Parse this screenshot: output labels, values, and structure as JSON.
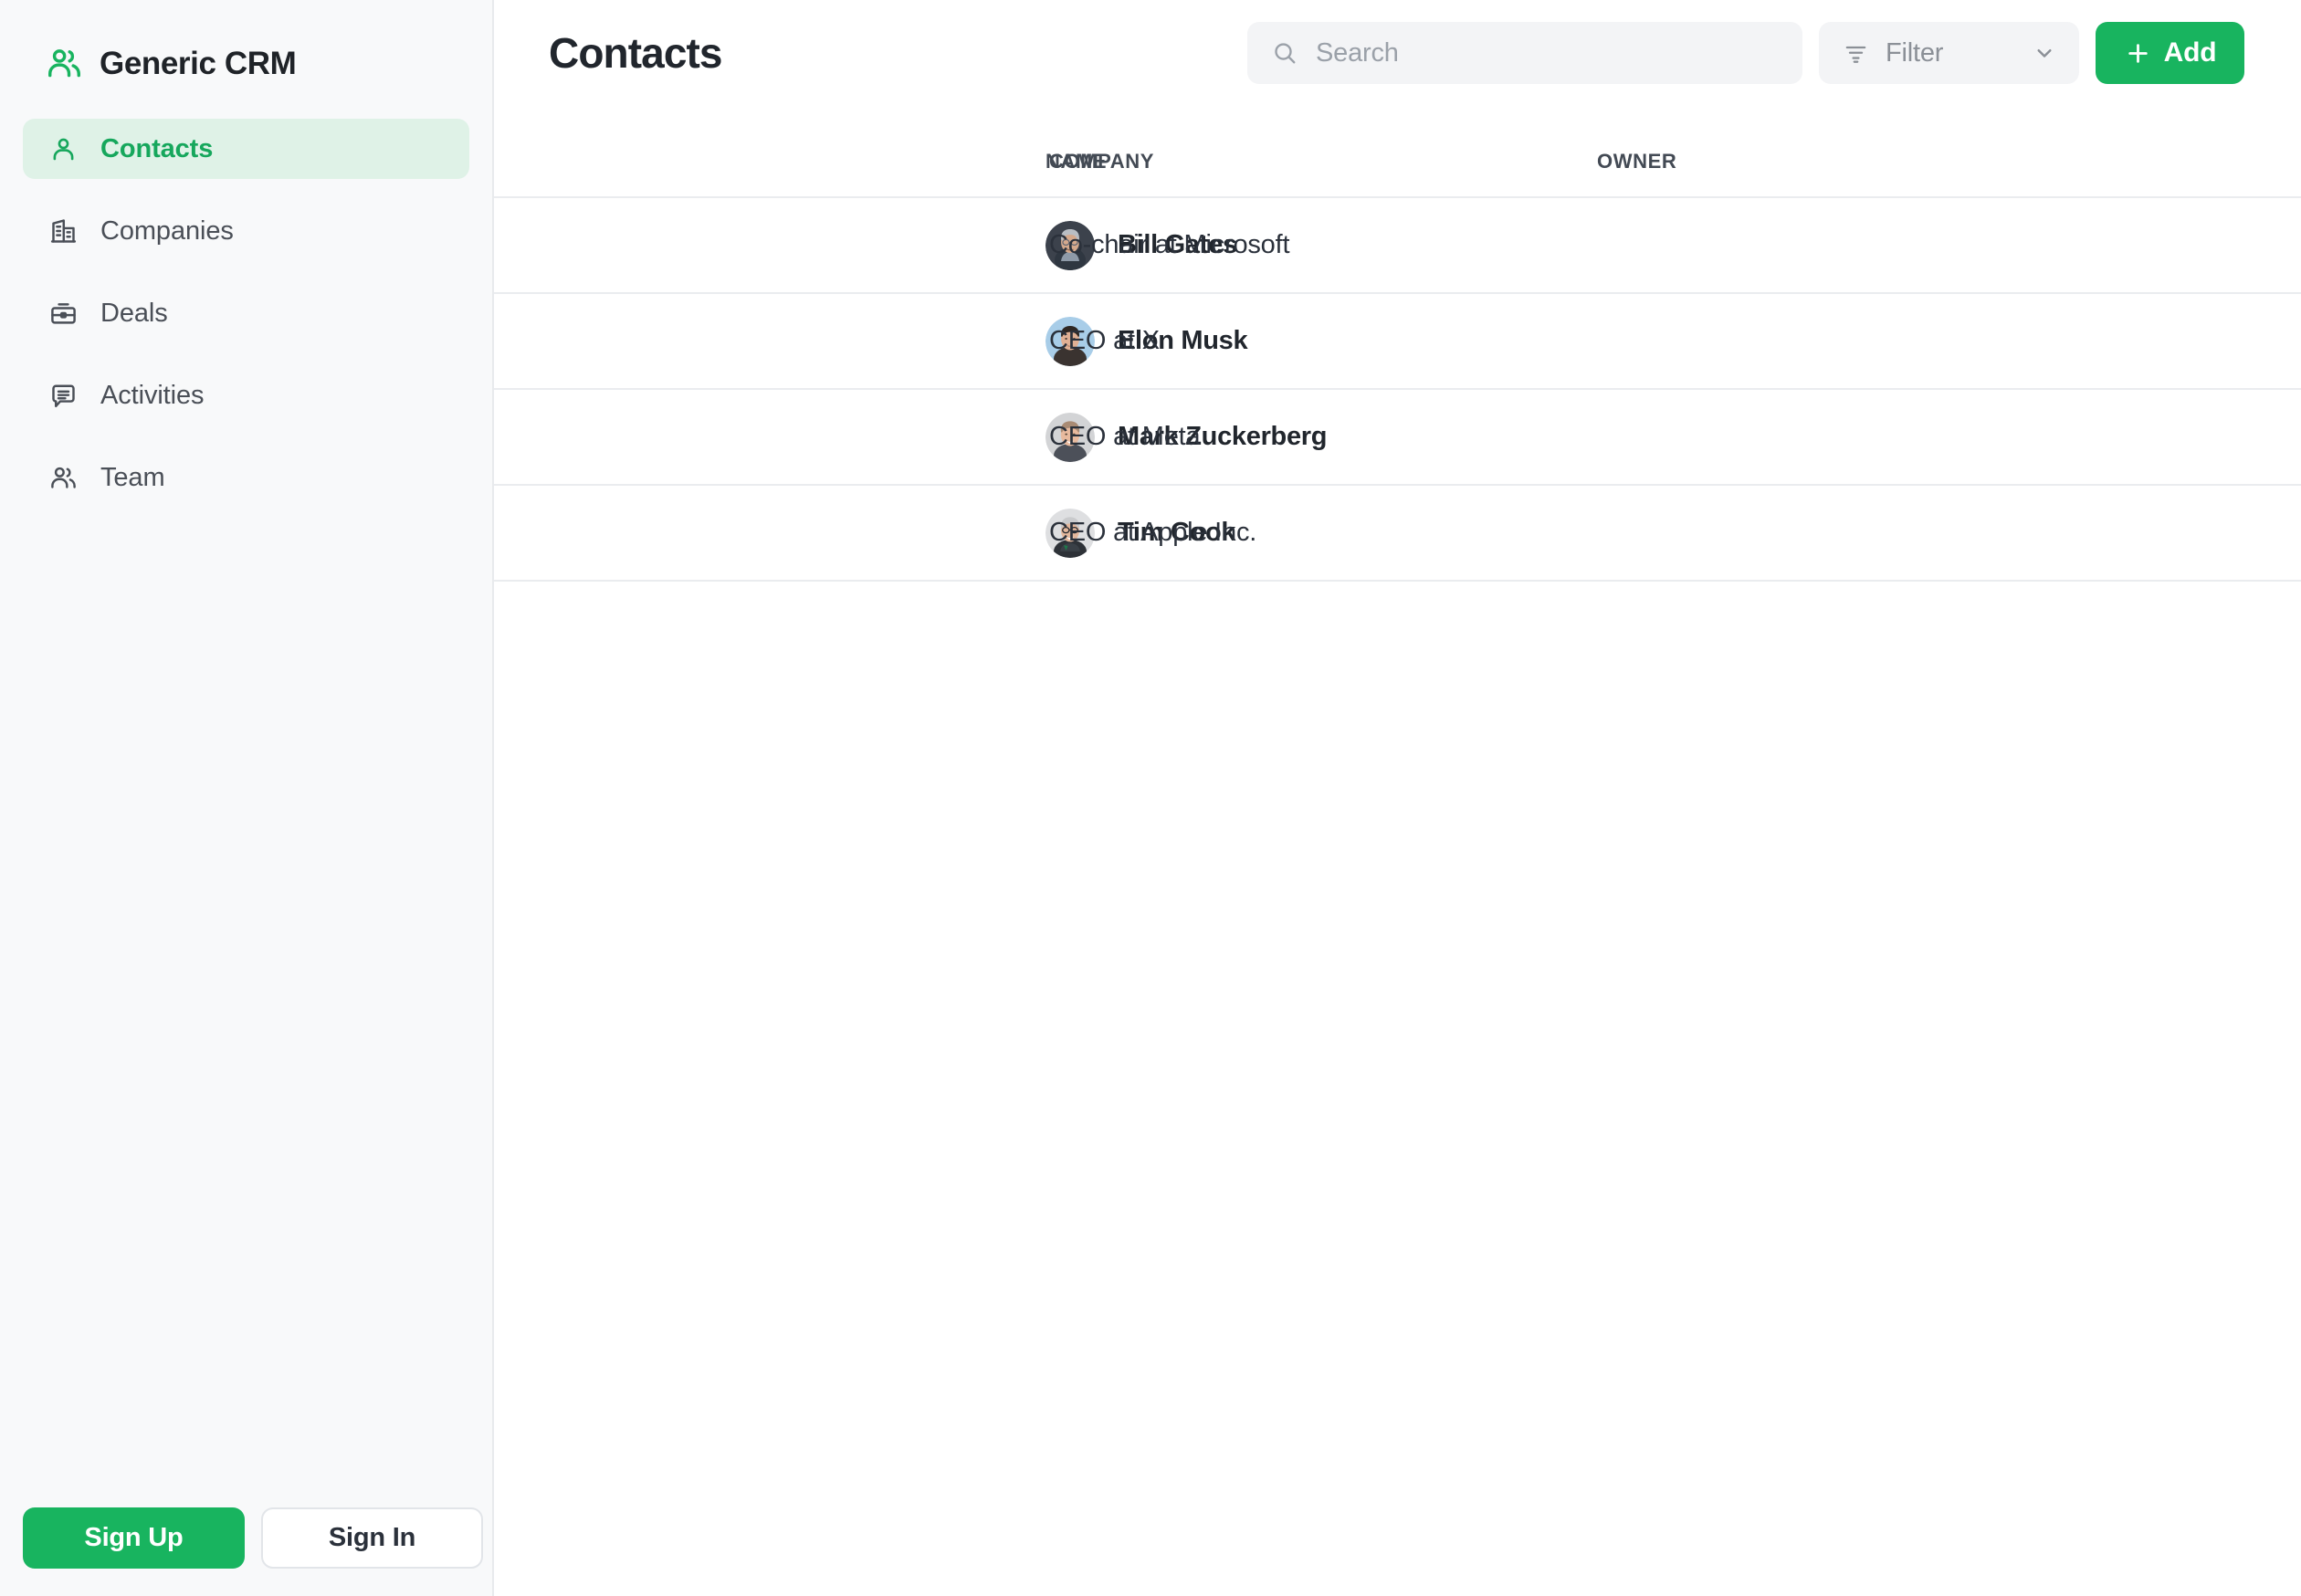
{
  "app": {
    "brand_name": "Generic CRM",
    "brand_icon": "users-icon",
    "accent_color": "#18B45F",
    "accent_text_color": "#16A75C",
    "active_nav_background": "#DFF2E7",
    "sidebar_background": "#F8F9FA",
    "main_background": "#FFFFFF",
    "divider_color": "#EAECEF"
  },
  "sidebar": {
    "items": [
      {
        "label": "Contacts",
        "icon": "person-icon",
        "active": true
      },
      {
        "label": "Companies",
        "icon": "building-icon",
        "active": false
      },
      {
        "label": "Deals",
        "icon": "briefcase-icon",
        "active": false
      },
      {
        "label": "Activities",
        "icon": "message-icon",
        "active": false
      },
      {
        "label": "Team",
        "icon": "users-icon",
        "active": false
      }
    ],
    "footer": {
      "sign_up_label": "Sign Up",
      "sign_in_label": "Sign In"
    }
  },
  "header": {
    "title": "Contacts",
    "search": {
      "placeholder": "Search",
      "value": "",
      "icon": "search-icon"
    },
    "filter": {
      "label": "Filter",
      "icon": "filter-icon",
      "chevron": "chevron-down-icon"
    },
    "add": {
      "label": "Add",
      "icon": "plus-icon"
    }
  },
  "table": {
    "columns": [
      "NAME",
      "COMPANY",
      "OWNER"
    ],
    "rows": [
      {
        "name": "Bill Gates",
        "company": "Co-chair at Microsoft",
        "owner": "",
        "avatar": "bill-gates"
      },
      {
        "name": "Elon Musk",
        "company": "CEO at X",
        "owner": "",
        "avatar": "elon-musk"
      },
      {
        "name": "Mark Zuckerberg",
        "company": "CEO at Meta",
        "owner": "",
        "avatar": "mark-zuckerberg"
      },
      {
        "name": "Tim Cook",
        "company": "CEO at Apple Inc.",
        "owner": "",
        "avatar": "tim-cook"
      }
    ]
  }
}
